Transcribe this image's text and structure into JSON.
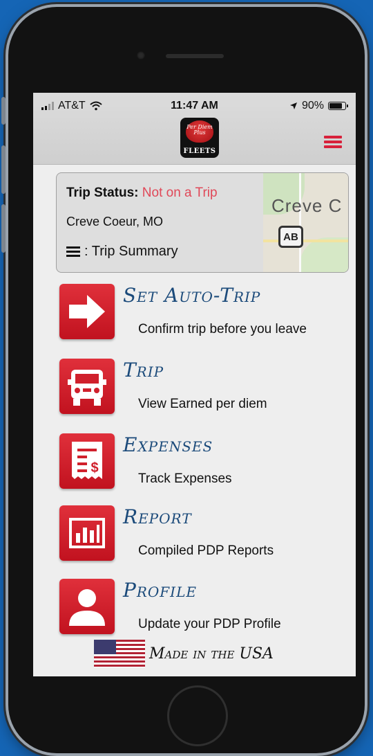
{
  "status_bar": {
    "carrier": "AT&T",
    "time": "11:47 AM",
    "battery_percent": "90%",
    "battery_level": 0.9
  },
  "header": {
    "logo_script": "Per Diem Plus",
    "logo_label": "FLEETS",
    "menu_icon": "hamburger-icon",
    "accent_color": "#d8213b"
  },
  "trip_card": {
    "status_label": "Trip Status:",
    "status_value": "Not on a Trip",
    "location": "Creve Coeur, MO",
    "summary_label": ": Trip Summary",
    "map_label": "Creve C",
    "map_pin_label": "AB"
  },
  "menu": [
    {
      "title": "Set Auto-Trip",
      "subtitle": "Confirm trip before you leave",
      "icon": "arrow-right-icon"
    },
    {
      "title": "Trip",
      "subtitle": "View Earned per diem",
      "icon": "truck-icon"
    },
    {
      "title": "Expenses",
      "subtitle": "Track Expenses",
      "icon": "receipt-icon"
    },
    {
      "title": "Report",
      "subtitle": "Compiled PDP Reports",
      "icon": "bar-chart-icon"
    },
    {
      "title": "Profile",
      "subtitle": "Update your PDP Profile",
      "icon": "user-icon"
    }
  ],
  "footer": {
    "text": "Made in the USA",
    "icon": "us-flag-icon"
  },
  "colors": {
    "title_blue": "#1b4a7a",
    "status_red": "#e04858",
    "icon_red": "#d0202c"
  }
}
